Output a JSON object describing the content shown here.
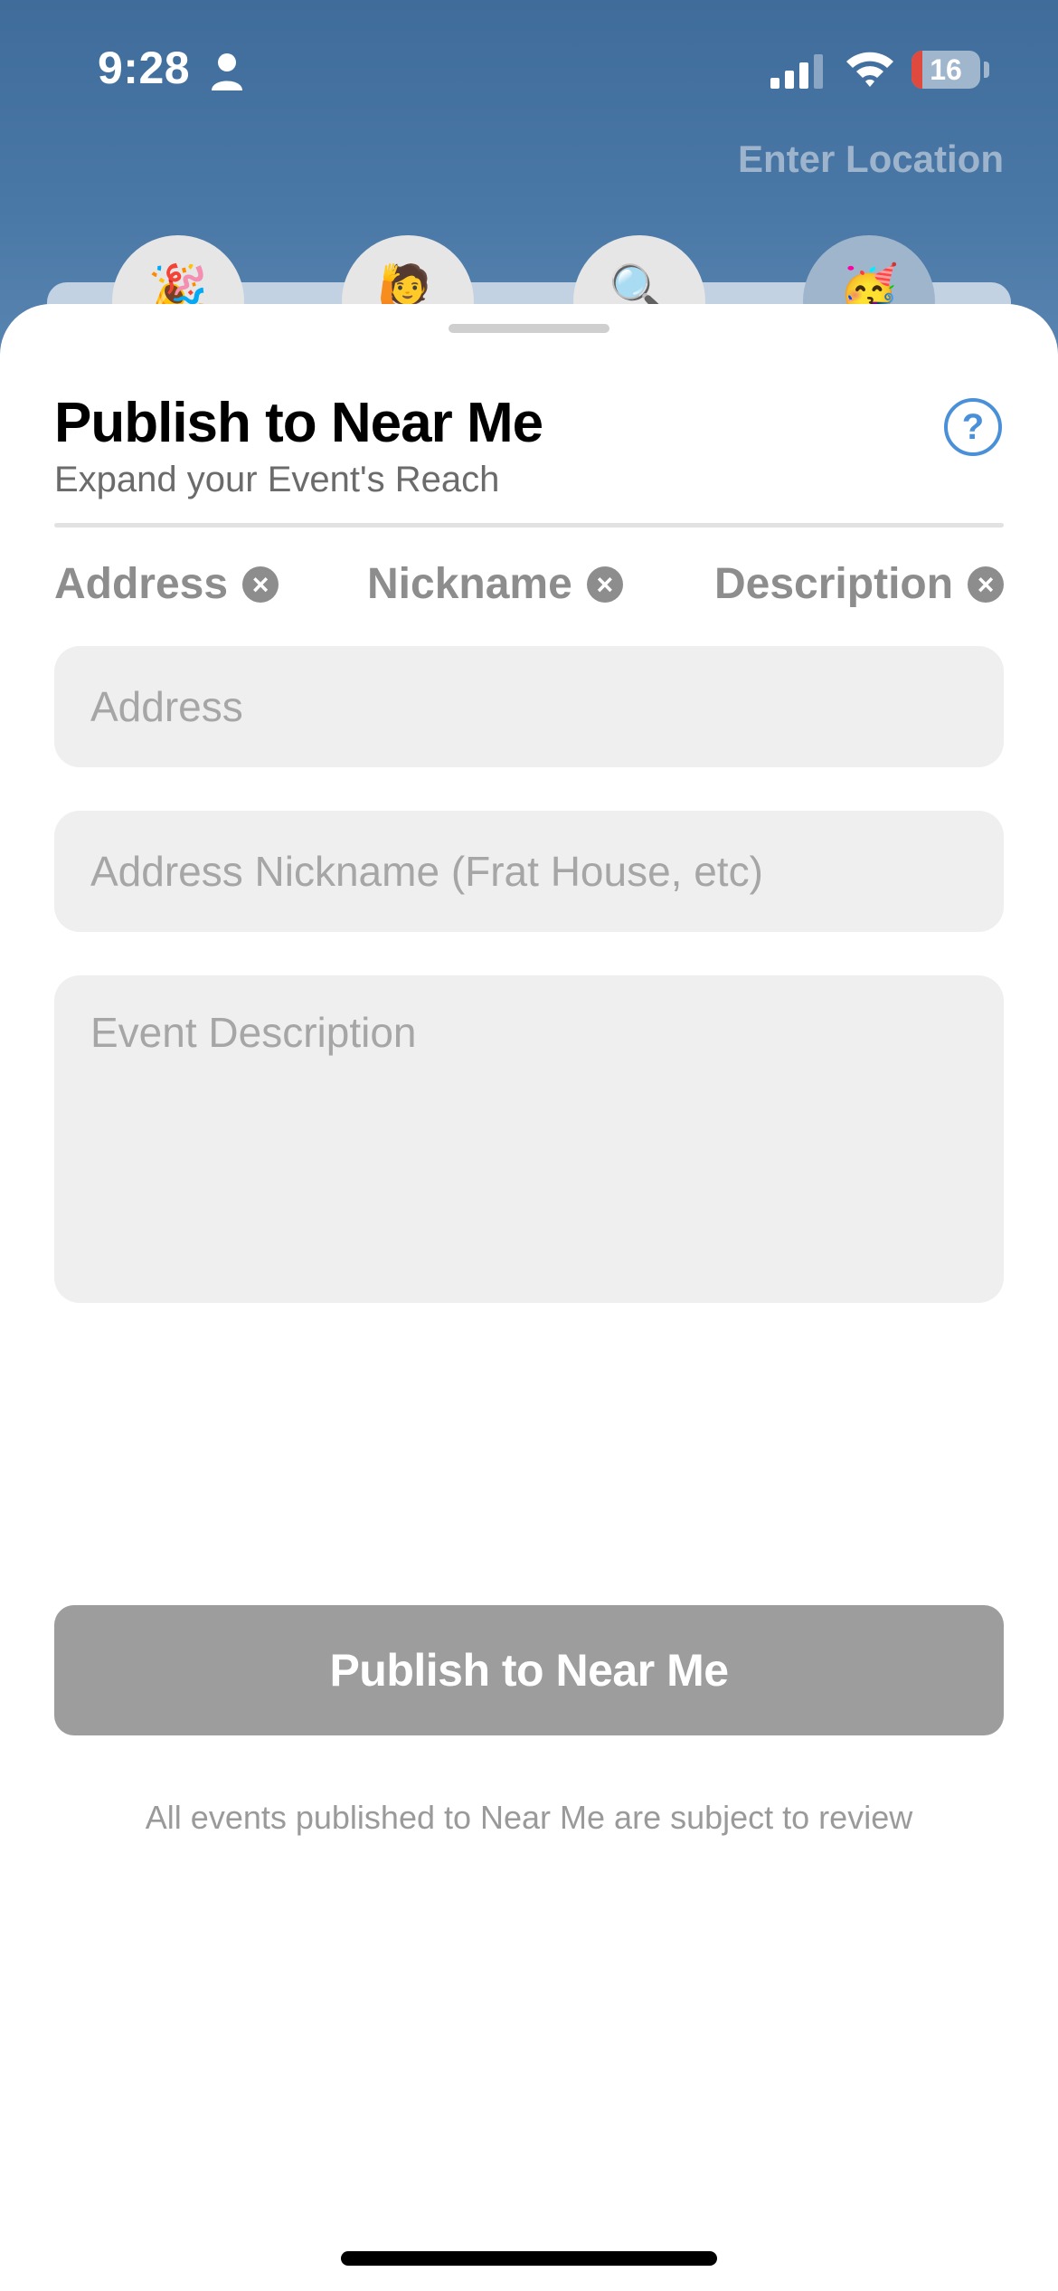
{
  "status_bar": {
    "time": "9:28",
    "battery_level": "16",
    "battery_fraction": 0.16
  },
  "header": {
    "enter_location": "Enter Location",
    "tabs": [
      {
        "icon": "party-popper-icon",
        "glyph": "🎉"
      },
      {
        "icon": "person-raising-hand-icon",
        "glyph": "🙋"
      },
      {
        "icon": "magnifying-glass-icon",
        "glyph": "🔍"
      },
      {
        "icon": "partying-face-icon",
        "glyph": "🥳"
      }
    ]
  },
  "sheet": {
    "title": "Publish to Near Me",
    "subtitle": "Expand your Event's Reach",
    "help_label": "?",
    "chips": [
      {
        "label": "Address",
        "remove": "×"
      },
      {
        "label": "Nickname",
        "remove": "×"
      },
      {
        "label": "Description",
        "remove": "×"
      }
    ],
    "fields": {
      "address_placeholder": "Address",
      "address_value": "",
      "nickname_placeholder": "Address Nickname (Frat House, etc)",
      "nickname_value": "",
      "description_placeholder": "Event Description",
      "description_value": ""
    },
    "publish_button": "Publish to Near Me",
    "review_note": "All events published to Near Me are subject to review"
  },
  "colors": {
    "header_blue": "#4a78a6",
    "accent_blue": "#4a90d9",
    "disabled_button": "#9d9d9d",
    "field_bg": "#efefef",
    "battery_red": "#e0493e"
  }
}
